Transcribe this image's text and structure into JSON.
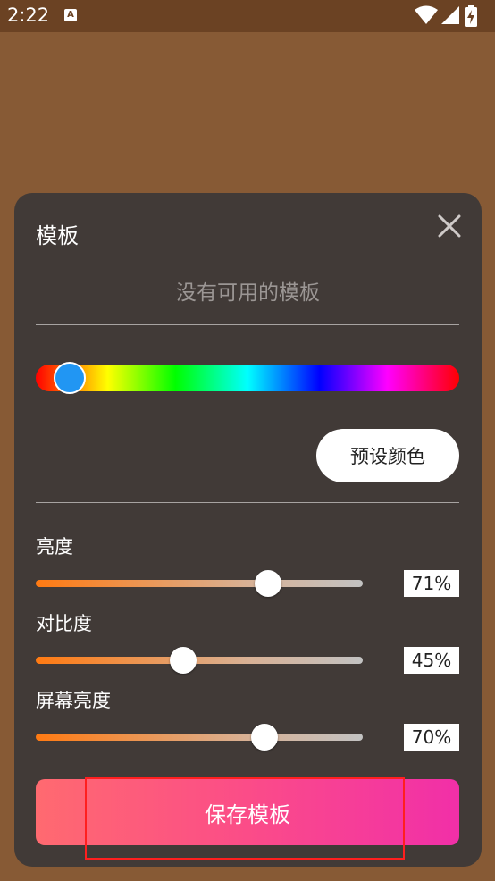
{
  "status_bar": {
    "time": "2:22",
    "notification_icon": "a-icon",
    "icons": [
      "wifi-icon",
      "signal-icon",
      "battery-charging-icon"
    ]
  },
  "dialog": {
    "title": "模板",
    "close_icon": "close-icon",
    "empty_message": "没有可用的模板",
    "hue_slider": {
      "value": 0.08,
      "knob_color": "#2196f3"
    },
    "preset_button_label": "预设颜色",
    "sliders": [
      {
        "label": "亮度",
        "value": 71,
        "display": "71%"
      },
      {
        "label": "对比度",
        "value": 45,
        "display": "45%"
      },
      {
        "label": "屏幕亮度",
        "value": 70,
        "display": "70%"
      }
    ],
    "save_button_label": "保存模板"
  },
  "colors": {
    "background": "#875a35",
    "dialog": "#413a37",
    "accent_orange": "#ff7a12",
    "save_gradient": [
      "#ff6a70",
      "#f12fa8"
    ]
  }
}
